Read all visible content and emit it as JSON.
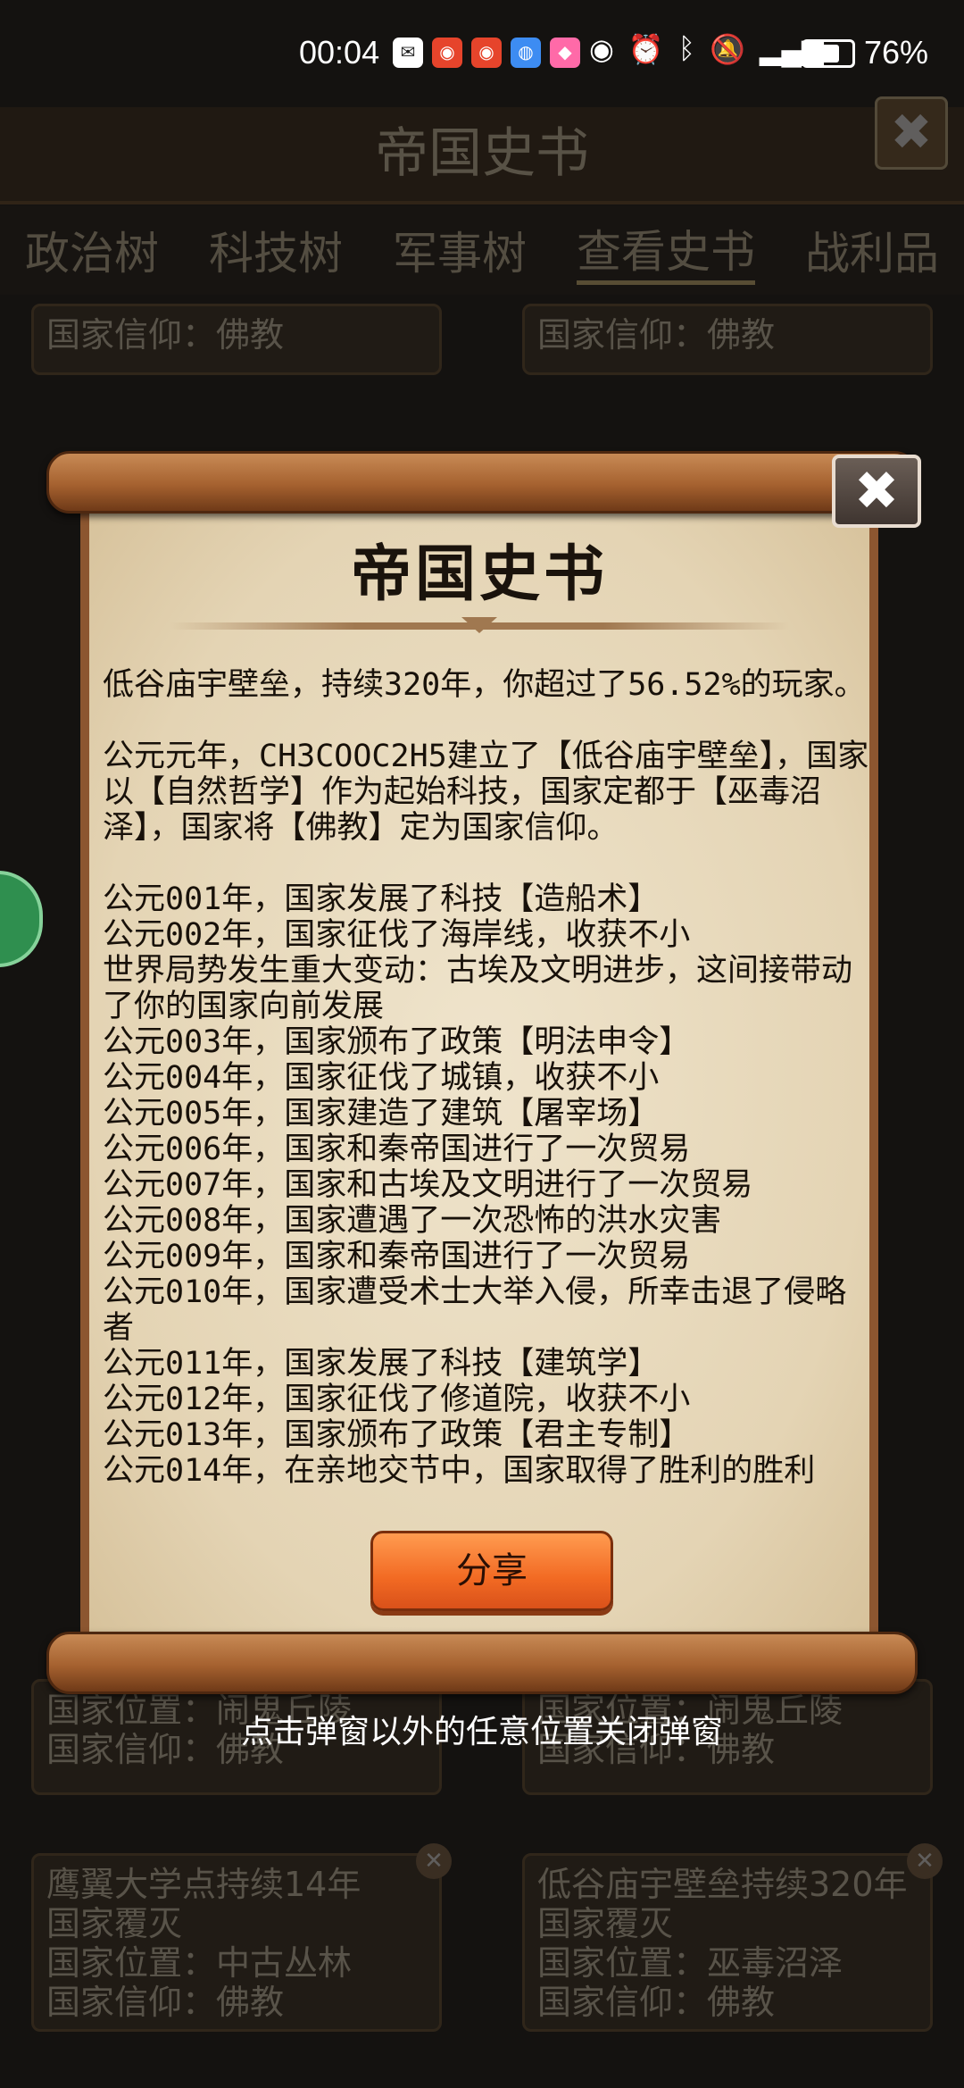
{
  "status_bar": {
    "time": "00:04",
    "battery": "76%",
    "notification_icons": [
      "message-icon",
      "weibo-icon",
      "weibo-icon",
      "browser-icon",
      "app-icon"
    ],
    "system_icons": [
      "eye-icon",
      "alarm-icon",
      "bluetooth-icon",
      "mute-icon",
      "signal-icon"
    ]
  },
  "background": {
    "title": "帝国史书",
    "close_label": "✖",
    "tabs": [
      "政治树",
      "科技树",
      "军事树",
      "查看史书",
      "战利品"
    ],
    "active_tab": "查看史书",
    "cards": [
      {
        "lines": [
          "国家信仰：佛教"
        ]
      },
      {
        "lines": [
          "国家信仰：佛教"
        ]
      },
      {
        "lines": [
          "国家位置：闹鬼丘陵",
          "国家信仰：佛教"
        ]
      },
      {
        "lines": [
          "国家位置：闹鬼丘陵",
          "国家信仰：佛教"
        ]
      },
      {
        "lines": [
          "鹰翼大学点持续14年",
          "国家覆灭",
          "国家位置：中古丛林",
          "国家信仰：佛教"
        ]
      },
      {
        "lines": [
          "低谷庙宇壁垒持续320年",
          "国家覆灭",
          "国家位置：巫毒沼泽",
          "国家信仰：佛教"
        ]
      }
    ]
  },
  "modal": {
    "title": "帝国史书",
    "summary": "低谷庙宇壁垒，持续320年，你超过了56.52%的玩家。",
    "founding": "公元元年，CH3COOC2H5建立了【低谷庙宇壁垒】，国家以【自然哲学】作为起始科技，国家定都于【巫毒沼泽】，国家将【佛教】定为国家信仰。",
    "events": [
      "公元001年，国家发展了科技【造船术】",
      "公元002年，国家征伐了海岸线，收获不小",
      "世界局势发生重大变动：古埃及文明进步，这间接带动了你的国家向前发展",
      "公元003年，国家颁布了政策【明法申令】",
      "公元004年，国家征伐了城镇，收获不小",
      "公元005年，国家建造了建筑【屠宰场】",
      "公元006年，国家和秦帝国进行了一次贸易",
      "公元007年，国家和古埃及文明进行了一次贸易",
      "公元008年，国家遭遇了一次恐怖的洪水灾害",
      "公元009年，国家和秦帝国进行了一次贸易",
      "公元010年，国家遭受术士大举入侵，所幸击退了侵略者",
      "公元011年，国家发展了科技【建筑学】",
      "公元012年，国家征伐了修道院，收获不小",
      "公元013年，国家颁布了政策【君主专制】",
      "公元014年，在亲地交节中，国家取得了胜利的胜利"
    ],
    "share_label": "分享",
    "close_label": "✖"
  },
  "hint": "点击弹窗以外的任意位置关闭弹窗"
}
